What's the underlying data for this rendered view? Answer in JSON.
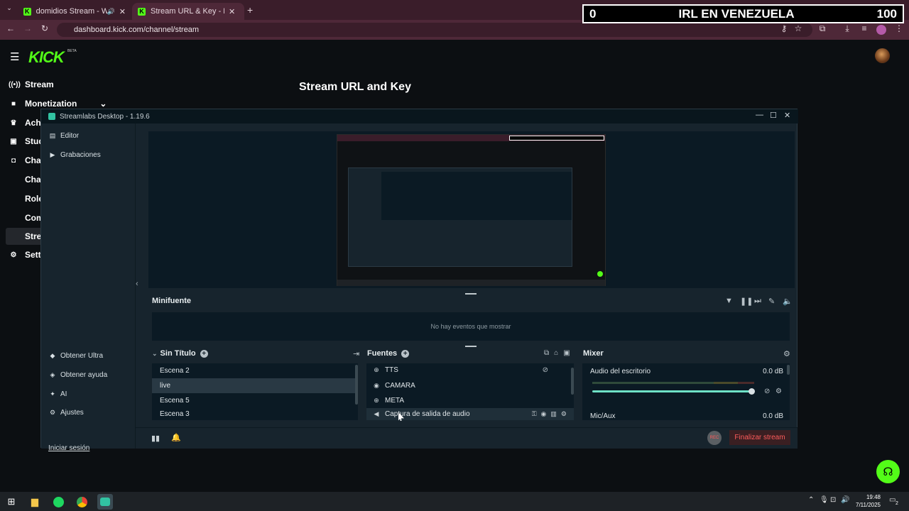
{
  "browser": {
    "tabs": [
      {
        "title": "domidios Stream - Watch Liv",
        "active": false
      },
      {
        "title": "Stream URL & Key - Kick Dashb",
        "active": true
      }
    ],
    "url": "dashboard.kick.com/channel/stream"
  },
  "overlay": {
    "left_count": "0",
    "title": "IRL EN VENEZUELA",
    "right_count": "100"
  },
  "kick": {
    "logo": "KICK",
    "beta": "BETA",
    "page_title": "Stream URL and Key",
    "nav": [
      {
        "label": "Stream",
        "icon": "broadcast-icon"
      },
      {
        "label": "Monetization",
        "icon": "dollar-icon"
      },
      {
        "label": "Achi",
        "icon": "trophy-icon"
      },
      {
        "label": "Stud",
        "icon": "studio-icon"
      },
      {
        "label": "Chan",
        "icon": "channel-icon"
      }
    ],
    "subnav": [
      "Chat",
      "Role",
      "Com",
      "Stre"
    ],
    "settings": "Setti"
  },
  "streamlabs": {
    "title": "Streamlabs Desktop - 1.19.6",
    "sidebar_top": [
      {
        "label": "Editor",
        "icon": "editor-icon"
      },
      {
        "label": "Grabaciones",
        "icon": "play-icon"
      }
    ],
    "sidebar_bottom": [
      {
        "label": "Obtener Ultra",
        "icon": "ultra-icon"
      },
      {
        "label": "Obtener ayuda",
        "icon": "help-icon"
      },
      {
        "label": "AI",
        "icon": "sparkle-icon"
      },
      {
        "label": "Ajustes",
        "icon": "gear-icon"
      }
    ],
    "login": "Iniciar sesión",
    "minifuente_title": "Minifuente",
    "no_events": "No hay eventos que mostrar",
    "scenes_title": "Sin Título",
    "scenes": [
      "Escena 2",
      "live",
      "Escena 5",
      "Escena 3"
    ],
    "selected_scene": "live",
    "sources_title": "Fuentes",
    "sources": [
      {
        "label": "TTS",
        "icon": "globe-icon"
      },
      {
        "label": "CAMARA",
        "icon": "camera-icon"
      },
      {
        "label": "META",
        "icon": "globe-icon"
      },
      {
        "label": "Captura de salida de audio",
        "icon": "speaker-icon"
      }
    ],
    "mixer_title": "Mixer",
    "mixer": [
      {
        "label": "Audio del escritorio",
        "db": "0.0 dB"
      },
      {
        "label": "Mic/Aux",
        "db": "0.0 dB"
      }
    ],
    "rec_label": "REC",
    "end_stream": "Finalizar stream"
  },
  "taskbar": {
    "time": "19:48",
    "date": "7/11/2025",
    "notifications": "2"
  }
}
